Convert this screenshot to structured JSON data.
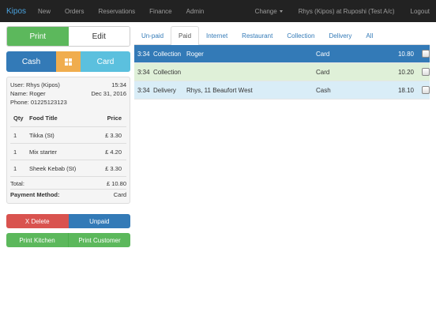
{
  "navbar": {
    "brand": "Kipos",
    "items": [
      "New",
      "Orders",
      "Reservations",
      "Finance",
      "Admin"
    ],
    "change_label": "Change",
    "user_label": "Rhys (Kipos) at Ruposhi (Test A/c)",
    "logout_label": "Logout"
  },
  "left": {
    "print_label": "Print",
    "edit_label": "Edit",
    "cash_label": "Cash",
    "card_label": "Card",
    "receipt": {
      "user": "User: Rhys (Kipos)",
      "time": "15:34",
      "name": "Name: Roger",
      "date": "Dec 31, 2016",
      "phone": "Phone: 01225123123",
      "headers": {
        "qty": "Qty",
        "title": "Food Title",
        "price": "Price"
      },
      "items": [
        {
          "qty": "1",
          "title": "Tikka (St)",
          "price": "£ 3.30"
        },
        {
          "qty": "1",
          "title": "Mix starter",
          "price": "£ 4.20"
        },
        {
          "qty": "1",
          "title": "Sheek Kebab (St)",
          "price": "£ 3.30"
        }
      ],
      "total_label": "Total:",
      "total_value": "£ 10.80",
      "payment_label": "Payment Method:",
      "payment_value": "Card"
    },
    "delete_label": "X Delete",
    "unpaid_label": "Unpaid",
    "print_kitchen_label": "Print Kitchen",
    "print_customer_label": "Print Customer"
  },
  "tabs": [
    "Un-paid",
    "Paid",
    "Internet",
    "Restaurant",
    "Collection",
    "Delivery",
    "All"
  ],
  "active_tab": "Paid",
  "orders": [
    {
      "time": "3:34",
      "type": "Collection",
      "customer": "Roger",
      "payment": "Card",
      "amount": "10.80",
      "bg": "#337ab7",
      "fg": "#ffffff"
    },
    {
      "time": "3:34",
      "type": "Collection",
      "customer": "",
      "payment": "Card",
      "amount": "10.20",
      "bg": "#dff0d8",
      "fg": "#333333"
    },
    {
      "time": "3:34",
      "type": "Delivery",
      "customer": "Rhys, 11 Beaufort West",
      "payment": "Cash",
      "amount": "18.10",
      "bg": "#d9edf7",
      "fg": "#333333"
    }
  ]
}
